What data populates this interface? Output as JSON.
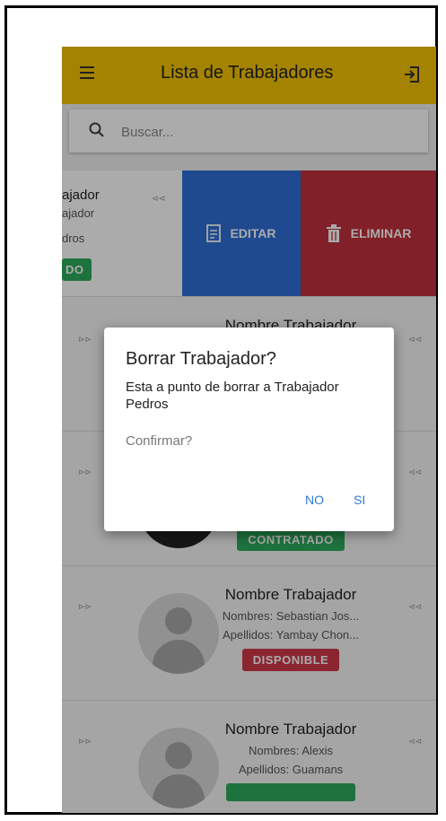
{
  "header": {
    "title": "Lista de Trabajadores"
  },
  "search": {
    "placeholder": "Buscar..."
  },
  "swiped_item": {
    "partial_title": "ajador",
    "partial_line1": "ajador",
    "partial_line2": "dros",
    "partial_chip": "DO",
    "edit_label": "EDITAR",
    "delete_label": "ELIMINAR"
  },
  "workers": [
    {
      "title": "Nombre Trabajador",
      "nombres": "",
      "apellidos": "",
      "status": "",
      "status_color": "#2eab5c"
    },
    {
      "title": "",
      "nombres": "",
      "apellidos": "",
      "status": "CONTRATADO",
      "status_color": "#2eab5c"
    },
    {
      "title": "Nombre Trabajador",
      "nombres": "Nombres: Sebastian Jos...",
      "apellidos": "Apellidos: Yambay Chon...",
      "status": "DISPONIBLE",
      "status_color": "#d0394a"
    },
    {
      "title": "Nombre Trabajador",
      "nombres": "Nombres: Alexis",
      "apellidos": "Apellidos: Guamans",
      "status": "",
      "status_color": "#2eab5c"
    }
  ],
  "dialog": {
    "title": "Borrar Trabajador?",
    "message": "Esta a punto de borrar a Trabajador Pedros",
    "confirm": "Confirmar?",
    "no_label": "NO",
    "yes_label": "SI"
  },
  "colors": {
    "appbar": "#f5c400",
    "edit": "#2f6fd6",
    "delete": "#c0303c",
    "accent": "#2e7ad8"
  }
}
